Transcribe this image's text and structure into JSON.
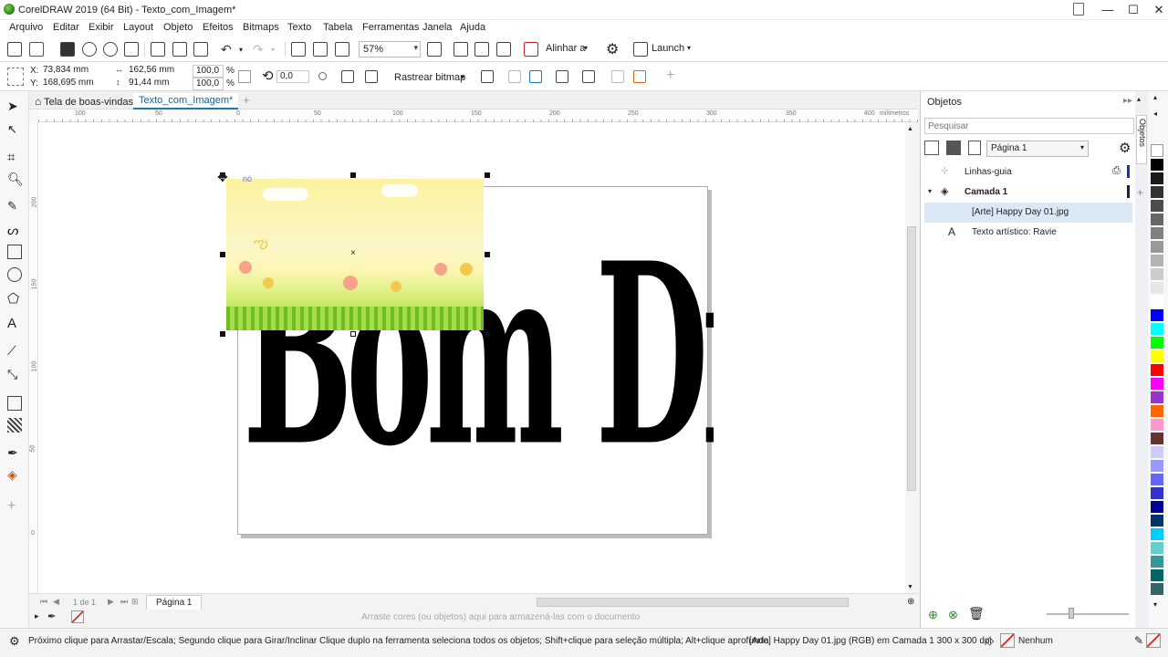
{
  "window": {
    "title": "CorelDRAW 2019 (64 Bit) - Texto_com_Imagem*",
    "minimize": "—",
    "maximize": "☐",
    "close": "✕"
  },
  "menu": [
    "Arquivo",
    "Editar",
    "Exibir",
    "Layout",
    "Objeto",
    "Efeitos",
    "Bitmaps",
    "Texto",
    "Tabela",
    "Ferramentas",
    "Janela",
    "Ajuda"
  ],
  "toolbar": {
    "zoom": "57%",
    "align_label": "Alinhar a",
    "launch_label": "Launch"
  },
  "propertybar": {
    "x_label": "X:",
    "x_value": "73,834 mm",
    "y_label": "Y:",
    "y_value": "168,695 mm",
    "w_value": "162,56 mm",
    "h_value": "91,44 mm",
    "scale_w": "100,0",
    "scale_h": "100,0",
    "pct": "%",
    "rotation": "0,0",
    "trace_bitmap": "Rastrear bitmap"
  },
  "doc_tabs": [
    "Tela de boas-vindas",
    "Texto_com_Imagem*"
  ],
  "ruler": {
    "h_ticks": [
      "100",
      "50",
      "0",
      "50",
      "100",
      "150",
      "200",
      "250",
      "300",
      "350",
      "400"
    ],
    "h_unit": "milímetros",
    "v_ticks": [
      "200",
      "150",
      "100",
      "50",
      "0"
    ]
  },
  "canvas": {
    "node_label": "nó",
    "art_text": "Bom Dia"
  },
  "page_nav": {
    "page_count": "1 de 1",
    "page_tab": "Página 1"
  },
  "color_dock_hint": "Arraste cores (ou objetos) aqui para armazená-las com o documento",
  "objects_panel": {
    "title": "Objetos",
    "search_placeholder": "Pesquisar",
    "page_select": "Página 1",
    "items": [
      {
        "label": "Linhas-guia"
      },
      {
        "label": "Camada 1"
      },
      {
        "label": "[Arte] Happy Day 01.jpg"
      },
      {
        "label": "Texto artístico: Ravie"
      }
    ],
    "side_tab": "Objetos"
  },
  "status": {
    "hint": "Próximo clique para Arrastar/Escala; Segundo clique para Girar/Inclinar Clique duplo na ferramenta seleciona todos os objetos; Shift+clique para seleção múltipla; Alt+clique aprofunda",
    "object_info": "[Arte] Happy Day 01.jpg (RGB) em Camada 1 300 x 300 dpi",
    "fill": "Nenhum"
  },
  "palette_colors": [
    "#000000",
    "#1a1a1a",
    "#333333",
    "#4d4d4d",
    "#666666",
    "#808080",
    "#999999",
    "#b3b3b3",
    "#cccccc",
    "#e6e6e6",
    "#ffffff",
    "#0000ff",
    "#00ffff",
    "#00ff00",
    "#ffff00",
    "#ff0000",
    "#ff00ff",
    "#9933cc",
    "#ff6600",
    "#ff99cc",
    "#663333",
    "#ccccff",
    "#9999ff",
    "#6666ff",
    "#3333cc",
    "#000099",
    "#003366",
    "#00ccff",
    "#66cccc",
    "#339999",
    "#006666",
    "#336666"
  ]
}
